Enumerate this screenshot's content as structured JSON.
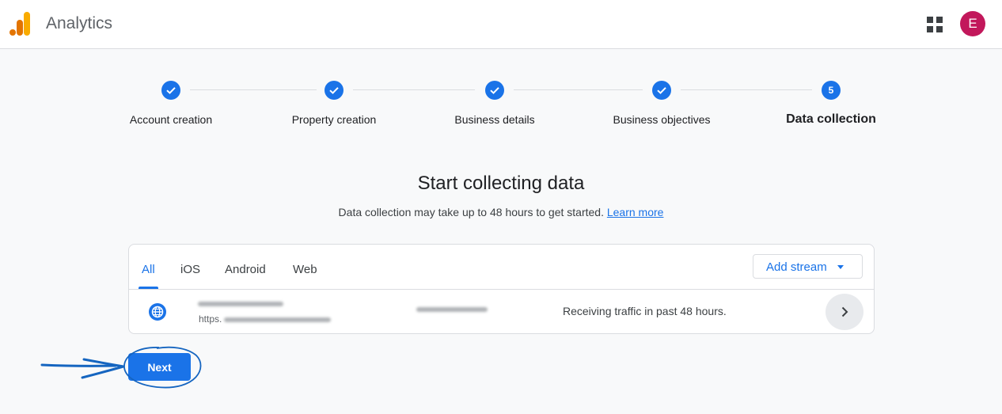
{
  "header": {
    "app_title": "Analytics",
    "avatar_initial": "E",
    "icons": [
      "analytics-logo-icon",
      "apps-grid-icon"
    ]
  },
  "stepper": {
    "steps": [
      {
        "label": "Account creation",
        "state": "done"
      },
      {
        "label": "Property creation",
        "state": "done"
      },
      {
        "label": "Business details",
        "state": "done"
      },
      {
        "label": "Business objectives",
        "state": "done"
      },
      {
        "label": "Data collection",
        "state": "active",
        "number": "5"
      }
    ]
  },
  "main": {
    "heading": "Start collecting data",
    "subtitle": "Data collection may take up to 48 hours to get started.",
    "learn_more": "Learn more"
  },
  "streams": {
    "tabs": [
      {
        "label": "All",
        "active": true
      },
      {
        "label": "iOS"
      },
      {
        "label": "Android"
      },
      {
        "label": "Web"
      }
    ],
    "add_stream_label": "Add stream",
    "row": {
      "url_prefix": "https.",
      "status": "Receiving traffic in past 48 hours."
    }
  },
  "footer": {
    "next_label": "Next"
  },
  "colors": {
    "accent": "#1a73e8",
    "avatar": "#c2185b",
    "annotation": "#1565c0"
  }
}
